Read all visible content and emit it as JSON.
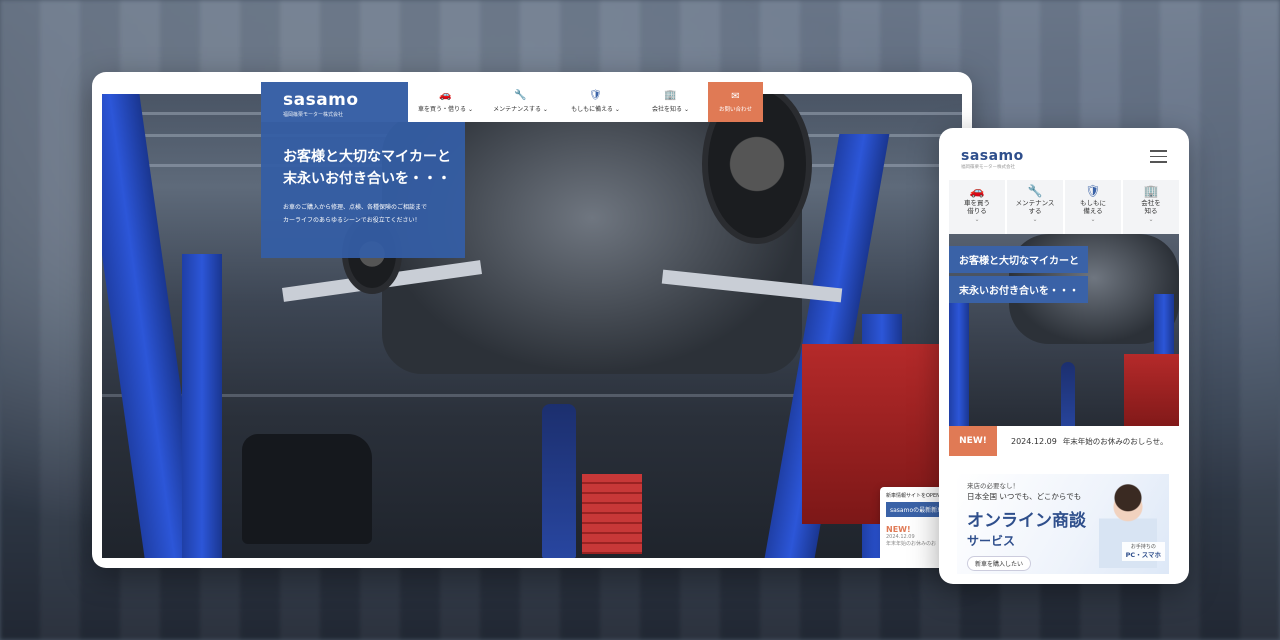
{
  "desktop": {
    "brand": "sasamo",
    "brand_sub": "福岡篠栗モーター株式会社",
    "nav": [
      {
        "label": "車を買う・借りる",
        "icon": "car-icon"
      },
      {
        "label": "メンテナンスする",
        "icon": "wrench-icon"
      },
      {
        "label": "もしもに備える",
        "icon": "shield-hands-icon"
      },
      {
        "label": "会社を知る",
        "icon": "building-icon"
      }
    ],
    "contact": {
      "label": "お問い合わせ",
      "icon": "mail-icon"
    },
    "hero": {
      "title_line1": "お客様と大切なマイカーと",
      "title_line2": "末永いお付き合いを・・・",
      "text_line1": "お車のご購入から修理、点検、各種保険のご相談まで",
      "text_line2": "カーライフのあらゆるシーンでお役立てください！"
    },
    "news_card": {
      "line1": "新車情報サイトをOPENし",
      "line2": "sasamoの最新新車",
      "new_label": "NEW!",
      "date": "2024.12.09",
      "text": "年末年始のお休みのお"
    }
  },
  "mobile": {
    "brand": "sasamo",
    "brand_sub": "福岡篠栗モーター株式会社",
    "nav": [
      {
        "line1": "車を買う",
        "line2": "借りる",
        "icon": "car-icon"
      },
      {
        "line1": "メンテナンス",
        "line2": "する",
        "icon": "wrench-icon"
      },
      {
        "line1": "もしもに",
        "line2": "備える",
        "icon": "shield-hands-icon"
      },
      {
        "line1": "会社を",
        "line2": "知る",
        "icon": "building-icon"
      }
    ],
    "hero": {
      "tag1": "お客様と大切なマイカーと",
      "tag2": "末永いお付き合いを・・・"
    },
    "news": {
      "new_label": "NEW!",
      "date": "2024.12.09",
      "text": "年末年始のお休みのおしらせ。"
    },
    "banner": {
      "small": "来店の必要なし！",
      "mid": "日本全国 いつでも、どこからでも",
      "big": "オンライン商談",
      "big2": "サービス",
      "button": "新車を購入したい",
      "device_small": "お手持ちの",
      "device": "PC・スマホ"
    }
  },
  "colors": {
    "primary": "#3a62a7",
    "accent": "#e07a55"
  }
}
